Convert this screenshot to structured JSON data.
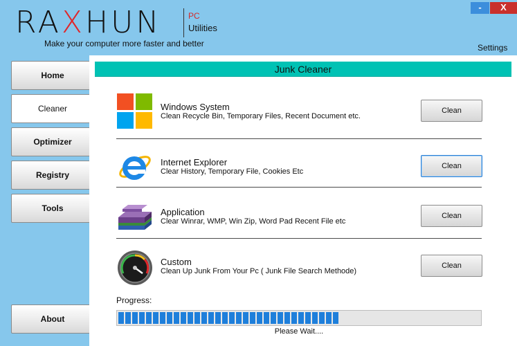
{
  "header": {
    "logo_pre": "RA",
    "logo_x": "X",
    "logo_post": "HUN",
    "logo_pc": "PC",
    "logo_utilities": "Utilities",
    "tagline": "Make your computer more faster and better",
    "settings_label": "Settings",
    "minimize_label": "-",
    "close_label": "X"
  },
  "sidebar": {
    "items": [
      {
        "label": "Home"
      },
      {
        "label": "Cleaner",
        "active": true
      },
      {
        "label": "Optimizer"
      },
      {
        "label": "Registry"
      },
      {
        "label": "Tools"
      }
    ],
    "about_label": "About"
  },
  "panel": {
    "title": "Junk Cleaner",
    "items": [
      {
        "title": "Windows System",
        "desc": "Clean Recycle Bin, Temporary Files, Recent Document etc.",
        "button": "Clean",
        "icon": "windows-logo-icon"
      },
      {
        "title": "Internet Explorer",
        "desc": "Clear History, Temporary File, Cookies Etc",
        "button": "Clean",
        "icon": "internet-explorer-icon"
      },
      {
        "title": "Application",
        "desc": "Clear Winrar, WMP, Win Zip, Word Pad Recent File etc",
        "button": "Clean",
        "icon": "application-books-icon"
      },
      {
        "title": "Custom",
        "desc": "Clean Up Junk From Your Pc ( Junk File Search Methode)",
        "button": "Clean",
        "icon": "speedometer-icon"
      }
    ],
    "progress_label": "Progress:",
    "progress_value": 0.61,
    "status": "Please Wait...."
  },
  "colors": {
    "background": "#86c7ec",
    "title_bar": "#00c2b4",
    "accent_red": "#e0262a",
    "progress_blue": "#1e7fdb"
  }
}
